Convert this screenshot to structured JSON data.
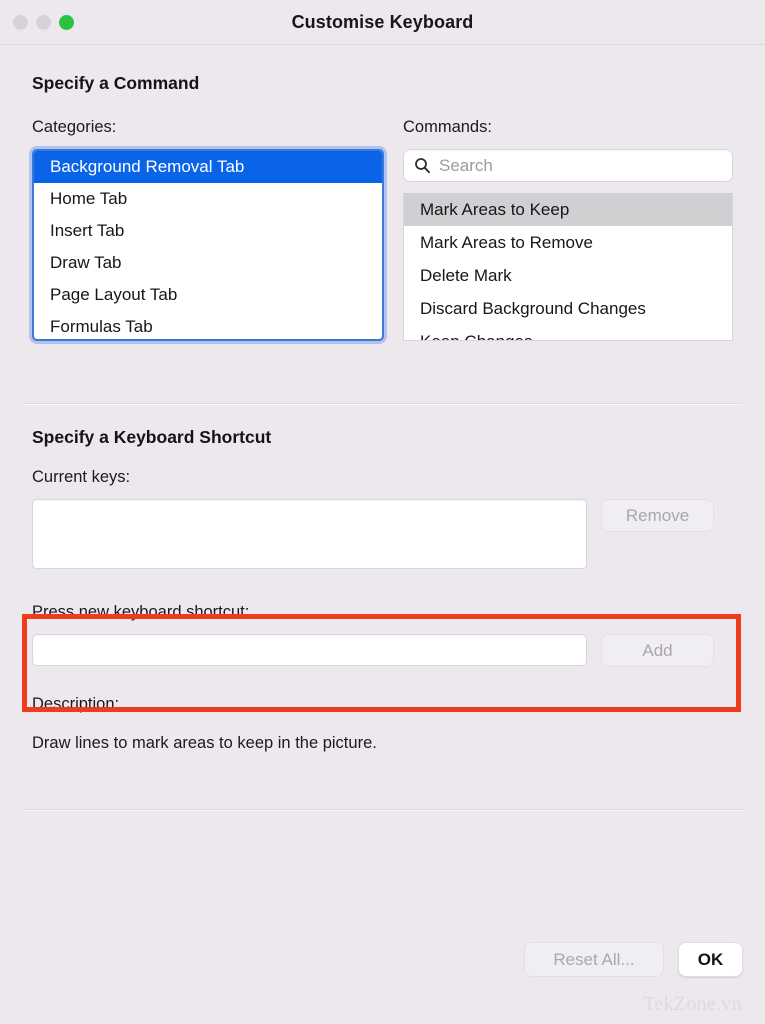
{
  "window": {
    "title": "Customise Keyboard",
    "traffic_lights": [
      {
        "name": "close",
        "state": "disabled"
      },
      {
        "name": "minimize",
        "state": "disabled"
      },
      {
        "name": "zoom",
        "state": "enabled"
      }
    ]
  },
  "command_section": {
    "title": "Specify a Command",
    "categories_label": "Categories:",
    "categories": [
      {
        "label": "Background Removal Tab",
        "selected": true
      },
      {
        "label": "Home Tab",
        "selected": false
      },
      {
        "label": "Insert Tab",
        "selected": false
      },
      {
        "label": "Draw Tab",
        "selected": false
      },
      {
        "label": "Page Layout Tab",
        "selected": false
      },
      {
        "label": "Formulas Tab",
        "selected": false
      }
    ],
    "commands_label": "Commands:",
    "search": {
      "placeholder": "Search",
      "value": "",
      "icon": "search-icon"
    },
    "commands": [
      {
        "label": "Mark Areas to Keep",
        "highlighted": true
      },
      {
        "label": "Mark Areas to Remove",
        "highlighted": false
      },
      {
        "label": "Delete Mark",
        "highlighted": false
      },
      {
        "label": "Discard Background Changes",
        "highlighted": false
      },
      {
        "label": "Keep Changes",
        "highlighted": false
      }
    ]
  },
  "shortcut_section": {
    "title": "Specify a Keyboard Shortcut",
    "current_keys_label": "Current keys:",
    "current_keys_value": "",
    "remove_button": "Remove",
    "press_new_label": "Press new keyboard shortcut:",
    "press_new_value": "",
    "add_button": "Add"
  },
  "description_section": {
    "label": "Description:",
    "text": "Draw lines to mark areas to keep in the picture."
  },
  "footer": {
    "reset_button": "Reset All...",
    "ok_button": "OK"
  },
  "watermark": "TekZone.vn",
  "colors": {
    "window_background": "#ece8ee",
    "selection_blue": "#0a64e8",
    "focus_ring": "#3d77d6",
    "inactive_selection": "#d0cfd1",
    "annotation_red": "#f03c1e",
    "zoom_green": "#2ac33f"
  }
}
